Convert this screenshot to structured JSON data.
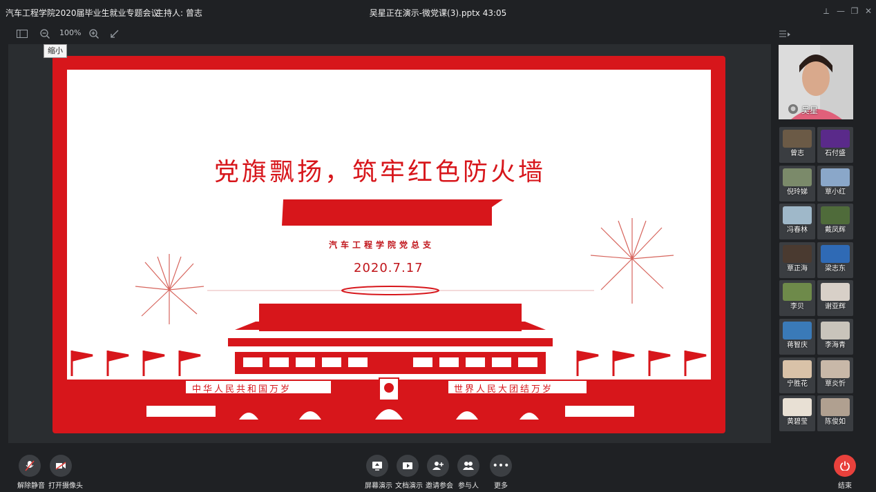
{
  "titlebar": {
    "meeting_title": "汽车工程学院2020届毕业生就业专题会议",
    "host": "主持人: 曾志",
    "presenting": "吴星正在演示-微党课(3).pptx 43:05"
  },
  "toolbar": {
    "zoom": "100%",
    "tooltip": "缩小"
  },
  "slide": {
    "title": "党旗飘扬，筑牢红色防火墙",
    "org": "汽车工程学院党总支",
    "date": "2020.7.17",
    "banner_left": "中华人民共和国万岁",
    "banner_right": "世界人民大团结万岁"
  },
  "speaker": {
    "name": "吴星"
  },
  "participants": [
    {
      "name": "曾志",
      "color": "#6b5a46"
    },
    {
      "name": "石付盛",
      "color": "#5a2a8a"
    },
    {
      "name": "倪玲娣",
      "color": "#7b8a6a"
    },
    {
      "name": "覃小红",
      "color": "#8aa7c9"
    },
    {
      "name": "冯春林",
      "color": "#9fb8c9"
    },
    {
      "name": "戴凤辉",
      "color": "#4f6b3a"
    },
    {
      "name": "覃正海",
      "color": "#4a3a30"
    },
    {
      "name": "梁志东",
      "color": "#2f6ab5"
    },
    {
      "name": "李贝",
      "color": "#6e8a4a"
    },
    {
      "name": "谢亚辉",
      "color": "#d8d0c8"
    },
    {
      "name": "蒋智庆",
      "color": "#3a7ab8"
    },
    {
      "name": "李海青",
      "color": "#c9c4bb"
    },
    {
      "name": "宁胜花",
      "color": "#d9c2a8"
    },
    {
      "name": "覃炎忻",
      "color": "#c8b8a8"
    },
    {
      "name": "黄碧莹",
      "color": "#e8e0d4"
    },
    {
      "name": "陈俊如",
      "color": "#b0a090"
    }
  ],
  "bottom": {
    "unmute": "解除静音",
    "camera": "打开摄像头",
    "screen_share": "屏幕演示",
    "doc_share": "文档演示",
    "invite": "邀请参会",
    "participants": "参与人",
    "more": "更多",
    "end": "结束"
  }
}
